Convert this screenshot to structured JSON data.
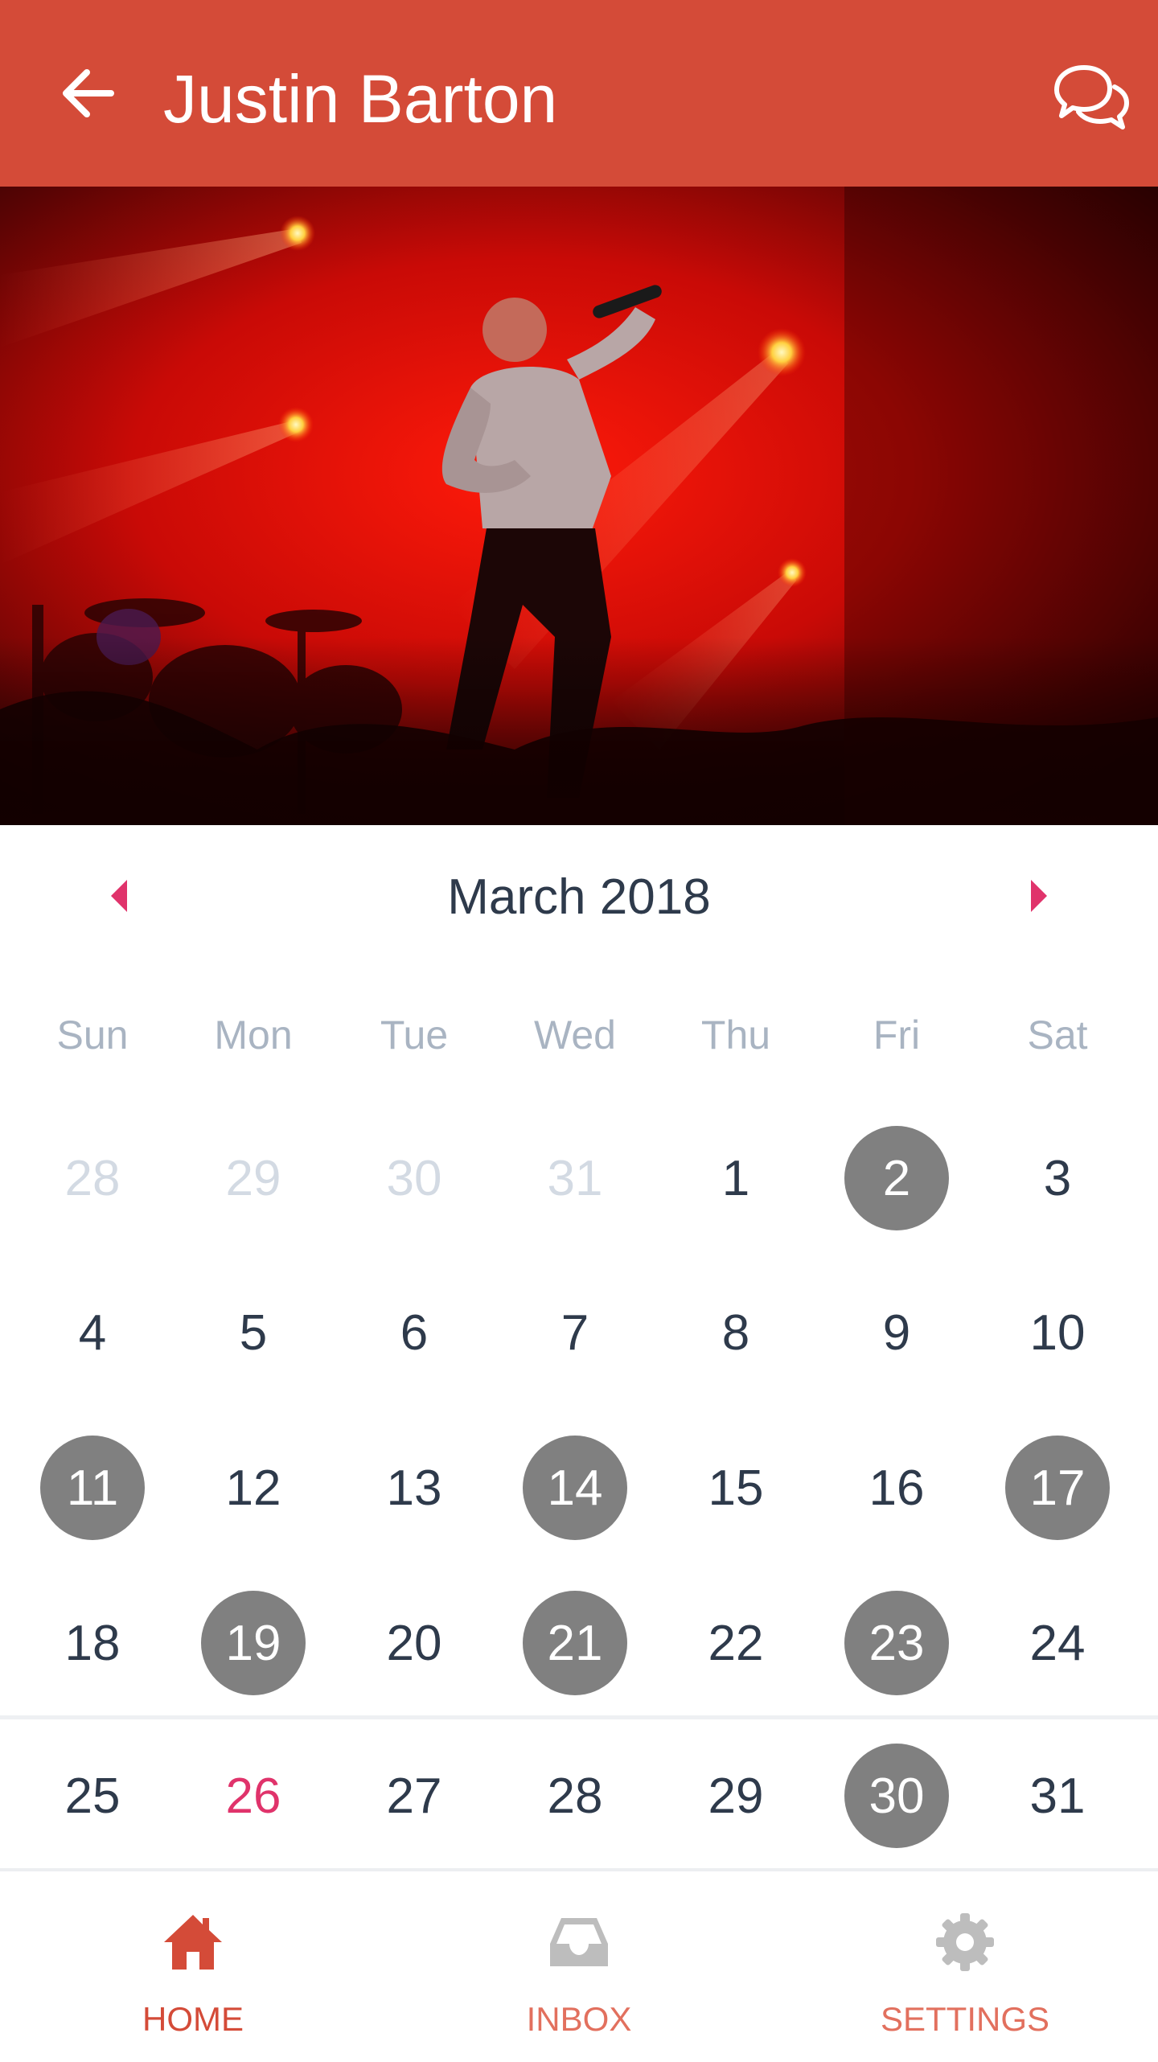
{
  "header": {
    "title": "Justin Barton",
    "back_icon": "arrow-left-icon",
    "chat_icon": "chat-bubbles-icon",
    "bar_color": "#D44B38"
  },
  "hero": {
    "description_icon": "concert-photo"
  },
  "calendar": {
    "month_label": "March 2018",
    "prev_icon": "triangle-left-icon",
    "next_icon": "triangle-right-icon",
    "accent_color": "#E0336B",
    "event_color": "#808080",
    "weekdays": [
      "Sun",
      "Mon",
      "Tue",
      "Wed",
      "Thu",
      "Fri",
      "Sat"
    ],
    "weeks": [
      [
        {
          "label": "28",
          "state": "muted"
        },
        {
          "label": "29",
          "state": "muted"
        },
        {
          "label": "30",
          "state": "muted"
        },
        {
          "label": "31",
          "state": "muted"
        },
        {
          "label": "1",
          "state": "normal"
        },
        {
          "label": "2",
          "state": "event"
        },
        {
          "label": "3",
          "state": "normal"
        }
      ],
      [
        {
          "label": "4",
          "state": "normal"
        },
        {
          "label": "5",
          "state": "normal"
        },
        {
          "label": "6",
          "state": "normal"
        },
        {
          "label": "7",
          "state": "normal"
        },
        {
          "label": "8",
          "state": "normal"
        },
        {
          "label": "9",
          "state": "normal"
        },
        {
          "label": "10",
          "state": "normal"
        }
      ],
      [
        {
          "label": "11",
          "state": "event"
        },
        {
          "label": "12",
          "state": "normal"
        },
        {
          "label": "13",
          "state": "normal"
        },
        {
          "label": "14",
          "state": "event"
        },
        {
          "label": "15",
          "state": "normal"
        },
        {
          "label": "16",
          "state": "normal"
        },
        {
          "label": "17",
          "state": "event"
        }
      ],
      [
        {
          "label": "18",
          "state": "normal"
        },
        {
          "label": "19",
          "state": "event"
        },
        {
          "label": "20",
          "state": "normal"
        },
        {
          "label": "21",
          "state": "event"
        },
        {
          "label": "22",
          "state": "normal"
        },
        {
          "label": "23",
          "state": "event"
        },
        {
          "label": "24",
          "state": "normal"
        }
      ],
      [
        {
          "label": "25",
          "state": "normal"
        },
        {
          "label": "26",
          "state": "today"
        },
        {
          "label": "27",
          "state": "normal"
        },
        {
          "label": "28",
          "state": "normal"
        },
        {
          "label": "29",
          "state": "normal"
        },
        {
          "label": "30",
          "state": "event"
        },
        {
          "label": "31",
          "state": "normal"
        }
      ]
    ]
  },
  "bottom_nav": {
    "items": [
      {
        "label": "HOME",
        "icon": "home-icon",
        "active": true
      },
      {
        "label": "INBOX",
        "icon": "inbox-icon",
        "active": false
      },
      {
        "label": "SETTINGS",
        "icon": "gear-icon",
        "active": false
      }
    ],
    "active_color": "#D44B38",
    "inactive_label_color": "#E2705E",
    "inactive_icon_color": "#BDBDBD"
  }
}
